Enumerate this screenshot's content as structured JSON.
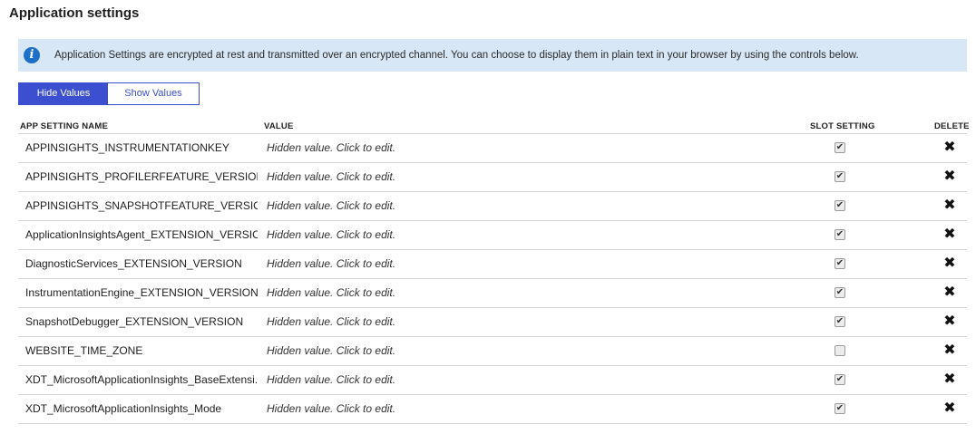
{
  "header": {
    "title": "Application settings"
  },
  "info": {
    "icon": "info-icon",
    "text": "Application Settings are encrypted at rest and transmitted over an encrypted channel. You can choose to display them in plain text in your browser by using the controls below."
  },
  "toggle": {
    "hide_label": "Hide Values",
    "show_label": "Show Values",
    "selected": "Hide Values"
  },
  "table": {
    "columns": {
      "name": "APP SETTING NAME",
      "value": "VALUE",
      "slot": "SLOT SETTING",
      "delete": "DELETE"
    },
    "rows": [
      {
        "name": "APPINSIGHTS_INSTRUMENTATIONKEY",
        "value": "Hidden value. Click to edit.",
        "slot": "✔",
        "delete": "✖"
      },
      {
        "name": "APPINSIGHTS_PROFILERFEATURE_VERSION",
        "value": "Hidden value. Click to edit.",
        "slot": "✔",
        "delete": "✖"
      },
      {
        "name": "APPINSIGHTS_SNAPSHOTFEATURE_VERSION",
        "value": "Hidden value. Click to edit.",
        "slot": "✔",
        "delete": "✖"
      },
      {
        "name": "ApplicationInsightsAgent_EXTENSION_VERSION",
        "value": "Hidden value. Click to edit.",
        "slot": "✔",
        "delete": "✖"
      },
      {
        "name": "DiagnosticServices_EXTENSION_VERSION",
        "value": "Hidden value. Click to edit.",
        "slot": "✔",
        "delete": "✖"
      },
      {
        "name": "InstrumentationEngine_EXTENSION_VERSION",
        "value": "Hidden value. Click to edit.",
        "slot": "✔",
        "delete": "✖"
      },
      {
        "name": "SnapshotDebugger_EXTENSION_VERSION",
        "value": "Hidden value. Click to edit.",
        "slot": "✔",
        "delete": "✖"
      },
      {
        "name": "WEBSITE_TIME_ZONE",
        "value": "Hidden value. Click to edit.",
        "slot": "",
        "delete": "✖"
      },
      {
        "name": "XDT_MicrosoftApplicationInsights_BaseExtensi...",
        "value": "Hidden value. Click to edit.",
        "slot": "✔",
        "delete": "✖"
      },
      {
        "name": "XDT_MicrosoftApplicationInsights_Mode",
        "value": "Hidden value. Click to edit.",
        "slot": "✔",
        "delete": "✖"
      }
    ]
  },
  "colors": {
    "accent": "#3b4fd0",
    "info_bg": "#d7e7f6",
    "info_icon": "#1e6fc8"
  }
}
